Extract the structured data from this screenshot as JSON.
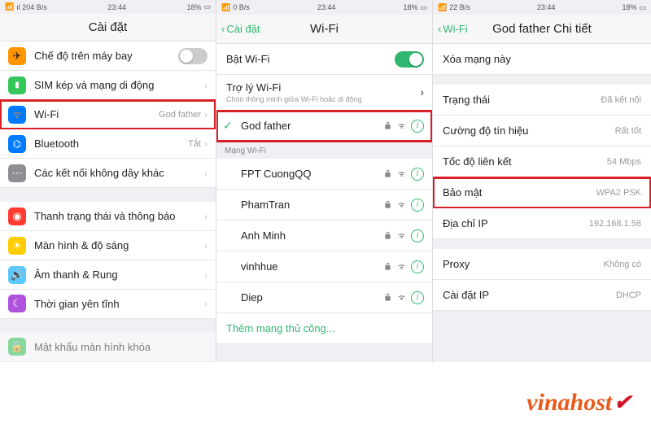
{
  "status": {
    "signal_a": "ıl 204 B/s",
    "signal_b": "0 B/s",
    "signal_c": "22 B/s",
    "time": "23:44",
    "battery": "18%"
  },
  "screen1": {
    "title": "Cài đặt",
    "rows": {
      "airplane": "Chế độ trên máy bay",
      "sim": "SIM kép và mạng di động",
      "wifi": "Wi-Fi",
      "wifi_val": "God father",
      "bt": "Bluetooth",
      "bt_val": "Tắt",
      "otherconn": "Các kết nối không dây khác",
      "statusbar": "Thanh trạng thái và thông báo",
      "display": "Màn hình & độ sáng",
      "sound": "Âm thanh & Rung",
      "quiet": "Thời gian yên tĩnh",
      "passcode": "Mật khẩu màn hình khóa"
    }
  },
  "screen2": {
    "back": "Cài đặt",
    "title": "Wi-Fi",
    "enable": "Bật Wi-Fi",
    "assist": "Trợ lý Wi-Fi",
    "assist_sub": "Chọn thông minh giữa Wi-Fi hoặc di động",
    "connected": "God father",
    "section": "Mạng Wi-Fi",
    "nets": [
      "FPT CuongQQ",
      "PhamTran",
      "Anh Minh",
      "vinhhue",
      "Diep"
    ],
    "addnet": "Thêm mạng thủ công..."
  },
  "screen3": {
    "back": "Wi-Fi",
    "title": "God father Chi tiết",
    "forget": "Xóa mạng này",
    "kv": {
      "status_k": "Trạng thái",
      "status_v": "Đã kết nối",
      "strength_k": "Cường độ tín hiệu",
      "strength_v": "Rất tốt",
      "speed_k": "Tốc độ liên kết",
      "speed_v": "54 Mbps",
      "sec_k": "Bảo mật",
      "sec_v": "WPA2 PSK",
      "ip_k": "Địa chỉ IP",
      "ip_v": "192.168.1.58",
      "proxy_k": "Proxy",
      "proxy_v": "Không có",
      "ipset_k": "Cài đặt IP",
      "ipset_v": "DHCP"
    }
  },
  "brand": "vinahost"
}
